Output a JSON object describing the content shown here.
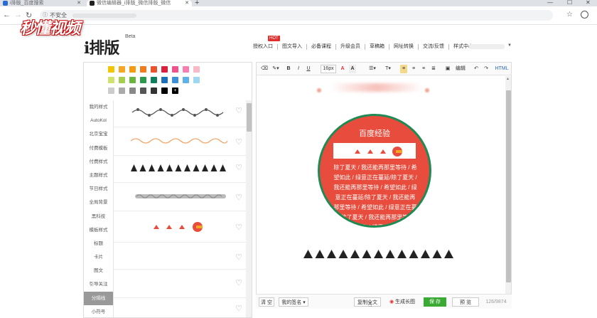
{
  "browser": {
    "tabs": [
      {
        "title": "i排版_百度搜索"
      },
      {
        "title": "微信编辑器_i排版_微信排版_微信"
      }
    ],
    "address": {
      "security_label": "不安全"
    }
  },
  "watermark": {
    "text": "秒懂视频"
  },
  "site": {
    "logo": "i排版",
    "beta": "Beta",
    "hot_badge": "HOT",
    "nav": [
      "授权入口",
      "图文导入",
      "必备课程",
      "升级会员",
      "草稿箱",
      "网址转换",
      "交流/反馈",
      "样式中心"
    ]
  },
  "palette": {
    "rows": [
      [
        "#f5c400",
        "#f5a623",
        "#f39c12",
        "#f07c1e",
        "#e8552d",
        "#d9213f",
        "#f0528c",
        "#f47fb0",
        "#f8b9c9"
      ],
      [
        "#cde36b",
        "#a5cf4c",
        "#69b33f",
        "#2c9a4a",
        "#0d7f5f",
        "#1d6fb8",
        "#3d8fd8",
        "#5eb2e8",
        "#9fd7f2"
      ],
      [
        "#cccccc",
        "#aaaaaa",
        "#888888",
        "#555555",
        "#333333",
        "#000000",
        "plus"
      ]
    ]
  },
  "categories": [
    "我的样式",
    "AutoKol",
    "北京宝宝",
    "付费模板",
    "付费样式",
    "主题样式",
    "节日样式",
    "全局背景",
    "黑科技",
    "模板样式",
    "标题",
    "卡片",
    "图文",
    "引导关注",
    "分隔线",
    "小符号"
  ],
  "active_category": "分隔线",
  "toolbar": {
    "font_size": "16px",
    "font_color_label": "A",
    "bg_color_label": "A",
    "bold": "B",
    "italic": "I",
    "underline": "U",
    "list": "☰",
    "text_t": "T",
    "sup_i": "I",
    "edit_label": "编辑",
    "html_label": "HTML"
  },
  "editor": {
    "circle_title": "百度经验",
    "circle_text": "除了夏天 / 我还能再那里等待 / 希望如此 / 绿意正在蔓延/除了夏天 / 我还能再那里等待 / 希望如此 / 绿意正在蔓延/除了夏天 / 我还能再那里等待 / 希望如此 / 绿意正在蔓延/除了夏天 / 我还能再那里等待 / 希望如此 / 绿意正在蔓延"
  },
  "bottom": {
    "clear": "清 空",
    "my_signature": "我的签名",
    "copy": "复制全文",
    "long_image": "生成长图",
    "save": "保 存",
    "preview": "预 览",
    "char_count": "126/9874"
  },
  "colors": {
    "accent_green": "#3aaa35",
    "circle_red": "#e84c3d",
    "circle_border": "#1f8a54",
    "hot_red": "#e22d2d"
  }
}
